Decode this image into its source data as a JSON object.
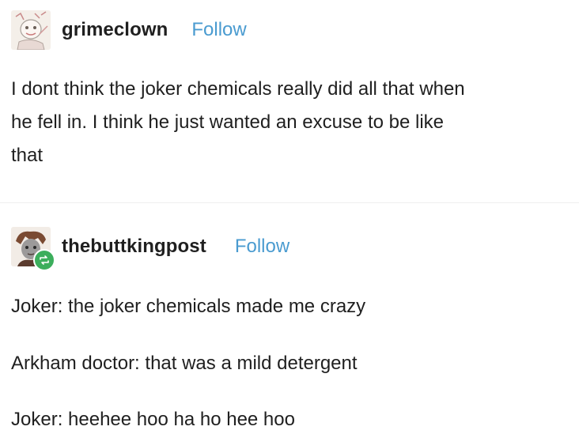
{
  "posts": [
    {
      "username": "grimeclown",
      "follow_label": "Follow",
      "lines": [
        "I dont think the joker chemicals really did all that when",
        "he fell in. I think he just wanted an excuse to be like",
        "that"
      ]
    },
    {
      "username": "thebuttkingpost",
      "follow_label": "Follow",
      "paragraphs": [
        "Joker: the joker chemicals made me crazy",
        "Arkham doctor: that was a mild detergent",
        "Joker: heehee hoo ha ho hee hoo"
      ]
    }
  ],
  "icons": {
    "avatar1": "avatar-sketch-icon",
    "avatar2": "avatar-character-icon",
    "reblog": "reblog-icon"
  },
  "colors": {
    "follow": "#4a9bd0",
    "reblog_badge": "#3cae5c",
    "text": "#1f1f1f"
  }
}
